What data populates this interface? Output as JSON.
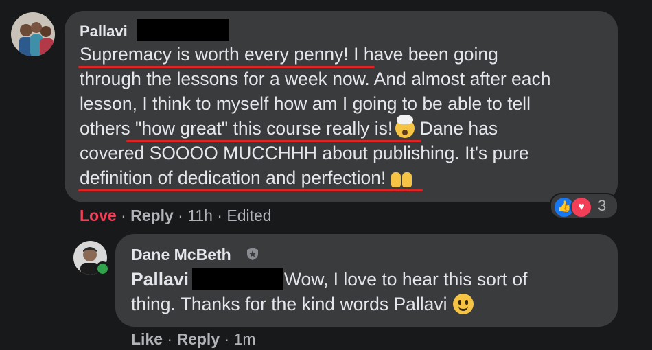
{
  "comment": {
    "author": "Pallavi",
    "lines": [
      "Supremacy is worth every penny! I have been going",
      "through the lessons for a week now. And almost after each",
      "lesson, I think to myself how am I going to be able to tell",
      "others \"how great\" this course really is!",
      " Dane has",
      "covered SOOOO MUCCHHH about publishing. It's pure",
      "definition of dedication and perfection!"
    ],
    "emojis": {
      "line4": "exploding-head-emoji",
      "line7": "raising-hands-emoji"
    },
    "actions": {
      "reaction": "Love",
      "reply": "Reply",
      "time": "11h",
      "edited": "Edited"
    },
    "reactions": {
      "icons": [
        "like-icon",
        "love-icon"
      ],
      "count": "3"
    },
    "accent": {
      "love": "#f33e58",
      "like": "#1877f2",
      "underline": "#e02424"
    }
  },
  "reply": {
    "author": "Dane McBeth",
    "badge_icon": "shield-icon",
    "mention": "Pallavi",
    "line1_rest": "Wow, I love to hear this sort of",
    "line2": "thing. Thanks for the kind words Pallavi",
    "emoji": "smiling-face-emoji",
    "actions": {
      "like": "Like",
      "reply": "Reply",
      "time": "1m"
    }
  },
  "colors": {
    "background": "#18191a",
    "bubble": "#3a3b3c",
    "text": "#e4e6eb",
    "muted": "#b0b3b8",
    "online": "#31a24c"
  }
}
